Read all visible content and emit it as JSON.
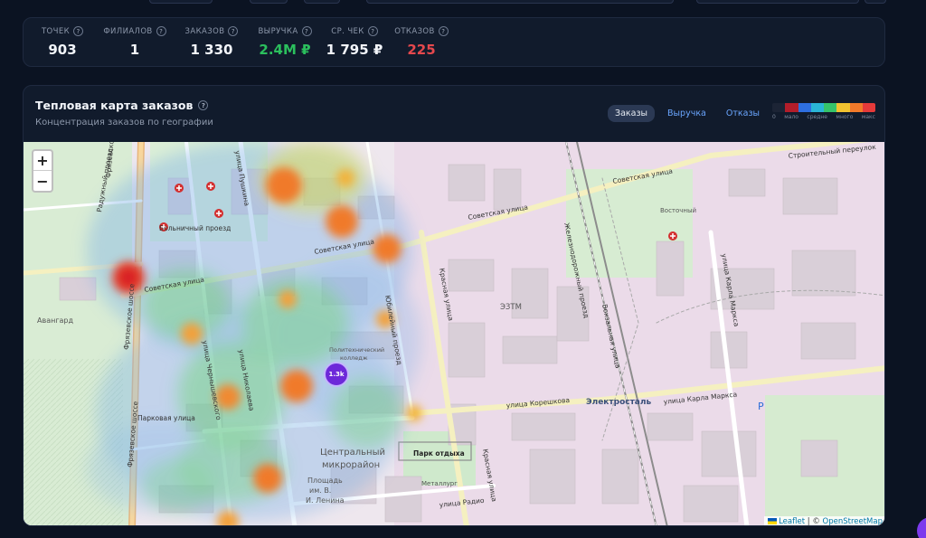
{
  "stats": [
    {
      "label": "ТОЧЕК",
      "value": "903",
      "tone": "normal"
    },
    {
      "label": "ФИЛИАЛОВ",
      "value": "1",
      "tone": "normal"
    },
    {
      "label": "ЗАКАЗОВ",
      "value": "1 330",
      "tone": "normal"
    },
    {
      "label": "ВЫРУЧКА",
      "value": "2.4M ₽",
      "tone": "green"
    },
    {
      "label": "СР. ЧЕК",
      "value": "1 795 ₽",
      "tone": "normal"
    },
    {
      "label": "ОТКАЗОВ",
      "value": "225",
      "tone": "red"
    }
  ],
  "help_glyph": "?",
  "heatmap": {
    "title": "Тепловая карта заказов",
    "subtitle": "Концентрация заказов по географии",
    "tabs": [
      "Заказы",
      "Выручка",
      "Отказы"
    ],
    "active_tab": "Заказы",
    "legend_labels": [
      "0",
      "мало",
      "средне",
      "много",
      "макс"
    ],
    "legend_colors": [
      "#1c2435",
      "#b31d2a",
      "#2e6fe0",
      "#2ab5d6",
      "#35c46a",
      "#f2c230",
      "#f27a2a",
      "#e53a3a"
    ]
  },
  "map": {
    "zoom_in": "+",
    "zoom_out": "−",
    "cluster_label": "1.3k",
    "attribution_leaflet": "Leaflet",
    "attribution_sep": " | © ",
    "attribution_osm": "OpenStreetMap",
    "streets": {
      "sovetskaya_1": "Советская улица",
      "sovetskaya_2": "Советская улица",
      "sovetskaya_3": "Советская улица",
      "sovetskaya_4": "Советская улица",
      "stroitelny": "Строительный переулок",
      "koreshkova": "улица Корешкова",
      "karla_marksa": "улица Карла Маркса",
      "karla_marksa_v": "улица Карла Маркса",
      "zheleznodorozhny": "Железнодорожный проезд",
      "krasnaya": "Красная улица",
      "krasnaya_2": "Красная улица",
      "nikolaeva": "улица Николаева",
      "chernyshevskogo": "улица Чернышевского",
      "pushkina": "улица Пушкина",
      "fryazevskoe_1": "Фрязевское шоссе",
      "fryazevskoe_2": "Фрязевское шоссе",
      "fryazevskoe_3": "Фрязевское шоссе",
      "parkovaya": "Парковая улица",
      "radio": "улица Радио",
      "yubileyny": "Юбилейный проезд",
      "vokzalnaya": "Вокзальная улица",
      "raduzhny": "Радужный проезд",
      "bolnichny": "Больничный проезд"
    },
    "places": {
      "ezm": "ЭЗТМ",
      "elektrostal": "Электросталь",
      "vostochny": "Восточный",
      "park": "Парк отдыха",
      "center1": "Центральный",
      "center2": "микрорайон",
      "ploshad1": "Площадь",
      "ploshad2": "им. В.",
      "ploshad3": "И. Ленина",
      "college1": "Политехнический",
      "college2": "колледж",
      "avangard": "Авангард",
      "metallurg": "Металлург",
      "parking": "P"
    }
  }
}
